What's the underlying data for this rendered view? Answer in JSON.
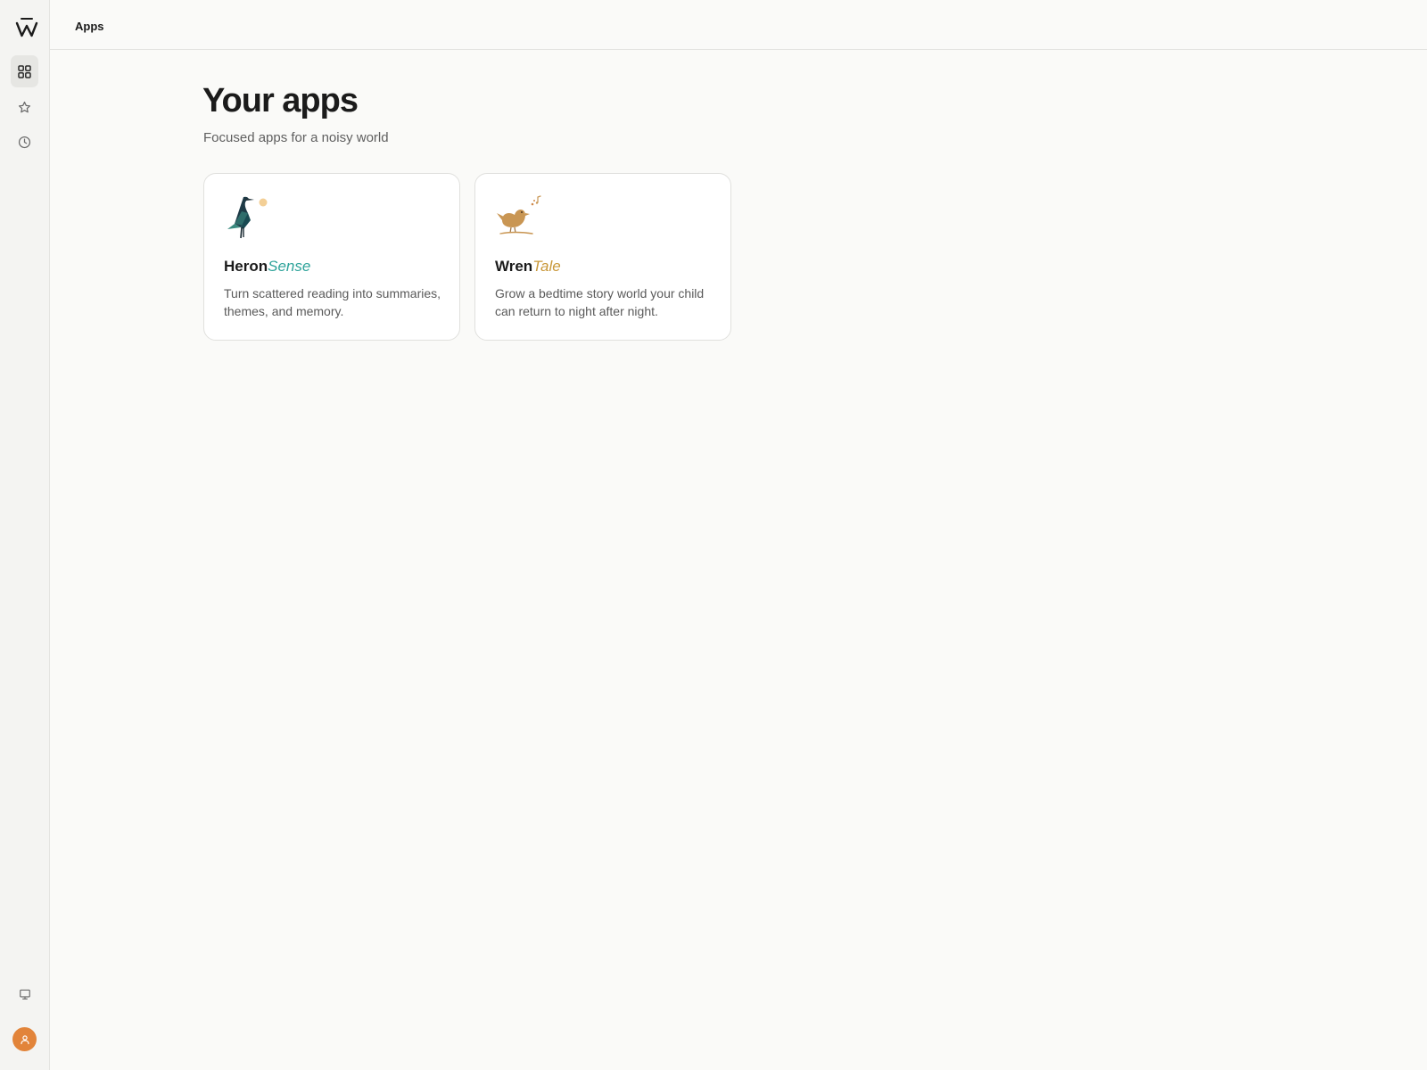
{
  "topbar": {
    "title": "Apps"
  },
  "sidebar": {
    "items": [
      {
        "name": "apps",
        "icon": "grid-icon",
        "active": true
      },
      {
        "name": "favorites",
        "icon": "star-icon",
        "active": false
      },
      {
        "name": "recent",
        "icon": "clock-icon",
        "active": false
      }
    ],
    "bottom": [
      {
        "name": "feedback",
        "icon": "monitor-icon"
      },
      {
        "name": "account",
        "icon": "user-icon"
      }
    ]
  },
  "main": {
    "title": "Your apps",
    "subtitle": "Focused apps for a noisy world",
    "apps": [
      {
        "name_main": "Heron",
        "name_accent": "Sense",
        "accent_color": "#2ea39a",
        "description": "Turn scattered reading into summaries, themes, and memory.",
        "icon": "heron-logo-icon"
      },
      {
        "name_main": "Wren",
        "name_accent": "Tale",
        "accent_color": "#c9983a",
        "description": "Grow a bedtime story world your child can return to night after night.",
        "icon": "wren-logo-icon"
      }
    ]
  },
  "colors": {
    "background": "#fafaf8",
    "sidebar": "#f4f4f2",
    "avatar": "#e2843a"
  }
}
